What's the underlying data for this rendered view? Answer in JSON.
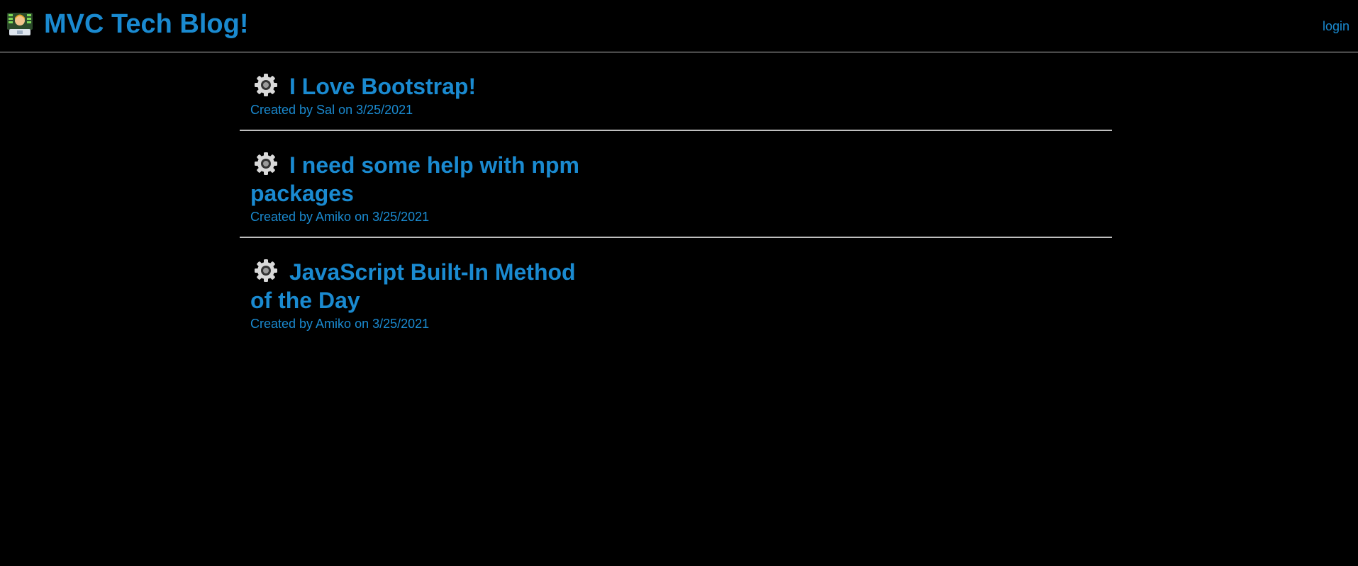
{
  "header": {
    "logo_icon": "technologist-icon",
    "title": "MVC Tech Blog!",
    "login_label": "login"
  },
  "colors": {
    "accent": "#1a8ad0",
    "background": "#000000",
    "divider": "#bfbfbf"
  },
  "posts": [
    {
      "icon": "gear-icon",
      "title": "I Love Bootstrap!",
      "meta": "Created by Sal on 3/25/2021"
    },
    {
      "icon": "gear-icon",
      "title": "I need some help with npm packages",
      "meta": "Created by Amiko on 3/25/2021"
    },
    {
      "icon": "gear-icon",
      "title": "JavaScript Built-In Method of the Day",
      "meta": "Created by Amiko on 3/25/2021"
    }
  ]
}
